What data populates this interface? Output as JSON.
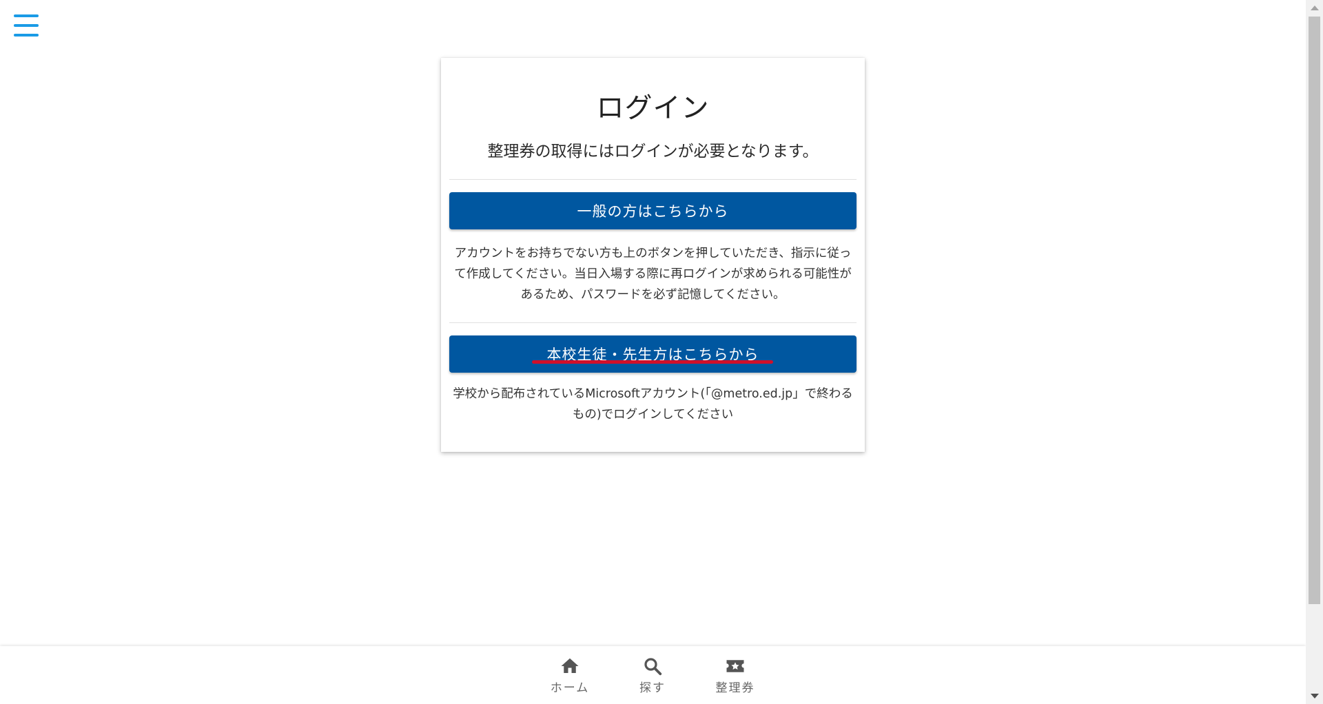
{
  "header": {
    "menu_icon": "hamburger-menu-icon"
  },
  "login": {
    "title": "ログイン",
    "subtitle": "整理券の取得にはログインが必要となります。",
    "general_button_label": "一般の方はこちらから",
    "general_description": "アカウントをお持ちでない方も上のボタンを押していただき、指示に従って作成してください。当日入場する際に再ログインが求められる可能性があるため、パスワードを必ず記憶してください。",
    "school_button_label": "本校生徒・先生方はこちらから",
    "school_description": "学校から配布されているMicrosoftアカウント(「@metro.ed.jp」で終わるもの)でログインしてください"
  },
  "bottom_nav": {
    "items": [
      {
        "label": "ホーム",
        "icon": "home-icon"
      },
      {
        "label": "探す",
        "icon": "search-icon"
      },
      {
        "label": "整理券",
        "icon": "ticket-icon"
      }
    ]
  },
  "colors": {
    "primary_button": "#0057a0",
    "menu_icon": "#1a9be6",
    "annotation_underline": "#d0102a",
    "nav_icon": "#555555"
  }
}
